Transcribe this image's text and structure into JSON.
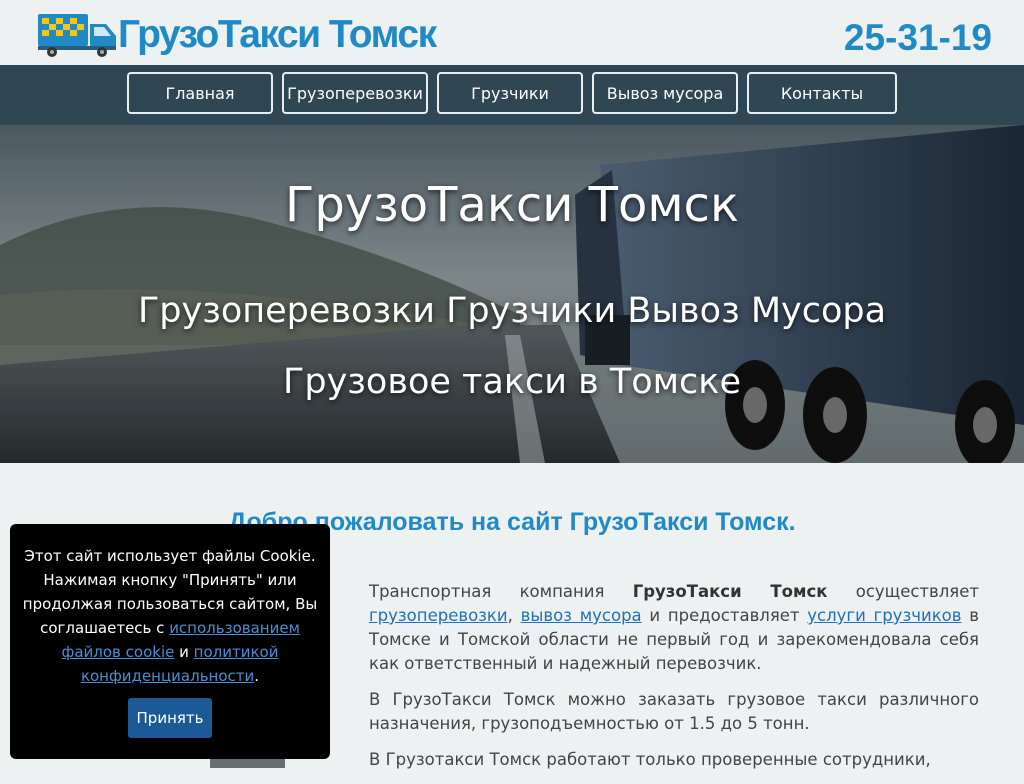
{
  "header": {
    "site_title": "ГрузоТакси Томск",
    "phone": "25-31-19"
  },
  "nav": {
    "items": [
      {
        "label": "Главная"
      },
      {
        "label": "Грузоперевозки"
      },
      {
        "label": "Грузчики"
      },
      {
        "label": "Вывоз мусора"
      },
      {
        "label": "Контакты"
      }
    ]
  },
  "hero": {
    "title": "ГрузоТакси Томск",
    "subtitle": "Грузоперевозки Грузчики Вывоз Мусора",
    "subtitle2": "Грузовое такси в Томске"
  },
  "main": {
    "welcome": "Добро пожаловать на сайт ГрузоТакси Томск.",
    "p1_text1": "Транспортная компания ",
    "p1_brand": "ГрузоТакси Томск",
    "p1_text2": " осуществляет ",
    "p1_link1": "грузоперевозки",
    "p1_sep": ", ",
    "p1_link2": "вывоз мусора",
    "p1_text3": " и предоставляет ",
    "p1_link3": "услуги грузчиков",
    "p1_text4": " в Томске и Томской области не первый год и зарекомендовала себя как ответственный и надежный перевозчик.",
    "p2": "В ГрузоТакси Томск можно заказать грузовое такси различного назначения, грузоподъемностью от 1.5 до 5 тонн.",
    "p3": "В Грузотакси Томск работают только проверенные сотрудники,"
  },
  "cookie": {
    "text1": "Этот сайт использует файлы Cookie. Нажимая кнопку \"Принять\" или продолжая пользоваться сайтом, Вы соглашаетесь с ",
    "link1": "использованием файлов cookie",
    "and": " и ",
    "link2": "политикой конфиденциальности",
    "dot": ".",
    "accept_label": "Принять"
  },
  "colors": {
    "brand_blue": "#1f8ac6",
    "nav_bg": "#2f4655",
    "cookie_button": "#1b5a96"
  }
}
